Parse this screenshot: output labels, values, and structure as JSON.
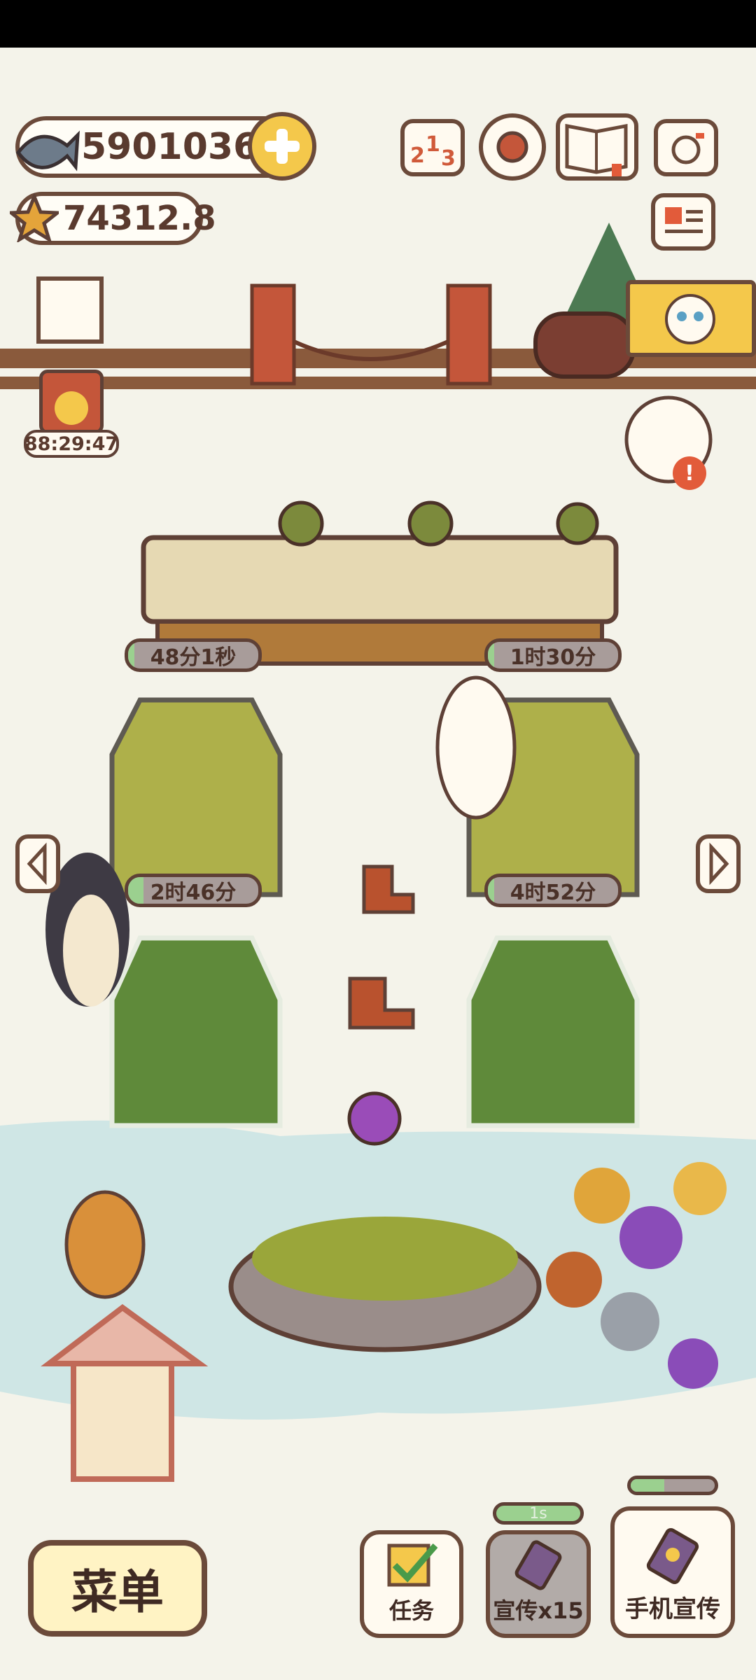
{
  "currency": {
    "fish_count": "5901036",
    "star_count": "74312.8"
  },
  "top_icons": [
    "leaderboard-icon",
    "settings-gear-icon",
    "catalog-book-icon",
    "camera-icon",
    "newspaper-icon"
  ],
  "event_timer": "88:29:47",
  "greenhouses": [
    {
      "time": "48分1秒",
      "progress": 0.05
    },
    {
      "time": "1时30分",
      "progress": 0.05
    },
    {
      "time": "2时46分",
      "progress": 0.12
    },
    {
      "time": "4时52分",
      "progress": 0.05
    }
  ],
  "bottom": {
    "menu_label": "菜单",
    "tasks_label": "任务",
    "promo_label": "宣传x15",
    "promo_cooldown": "1s",
    "phone_promo_label": "手机宣传",
    "phone_promo_progress": 0.4
  },
  "colors": {
    "outline": "#6b4a3a",
    "background": "#f4f3ea",
    "accent_yellow": "#f4c84b",
    "timer_green": "#9bd08f"
  }
}
